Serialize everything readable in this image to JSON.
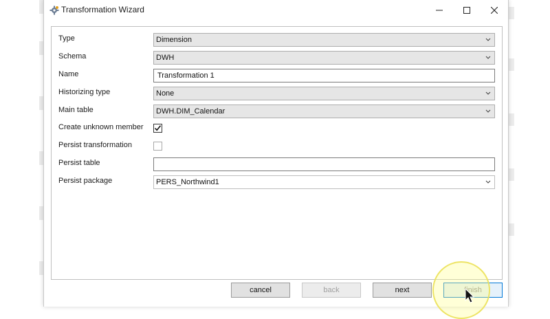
{
  "window": {
    "title": "Transformation Wizard"
  },
  "icons": {
    "app": "wizard-app-icon",
    "minimize": "minimize-icon",
    "maximize": "maximize-icon",
    "close": "close-icon",
    "dropdown": "chevron-down-icon",
    "check": "checkmark-icon",
    "cursor": "mouse-pointer-icon"
  },
  "form": {
    "type": {
      "label": "Type",
      "value": "Dimension"
    },
    "schema": {
      "label": "Schema",
      "value": "DWH"
    },
    "name": {
      "label": "Name",
      "value": "Transformation 1"
    },
    "historizing_type": {
      "label": "Historizing type",
      "value": "None"
    },
    "main_table": {
      "label": "Main table",
      "value": "DWH.DIM_Calendar"
    },
    "create_unknown_member": {
      "label": "Create unknown member",
      "checked": true
    },
    "persist_transformation": {
      "label": "Persist transformation",
      "checked": false
    },
    "persist_table": {
      "label": "Persist table",
      "value": ""
    },
    "persist_package": {
      "label": "Persist package",
      "value": "PERS_Northwind1"
    }
  },
  "buttons": {
    "cancel": "cancel",
    "back": "back",
    "next": "next",
    "finish": "finish"
  },
  "colors": {
    "accent": "#0078d7",
    "highlight": "#ffff8c"
  }
}
